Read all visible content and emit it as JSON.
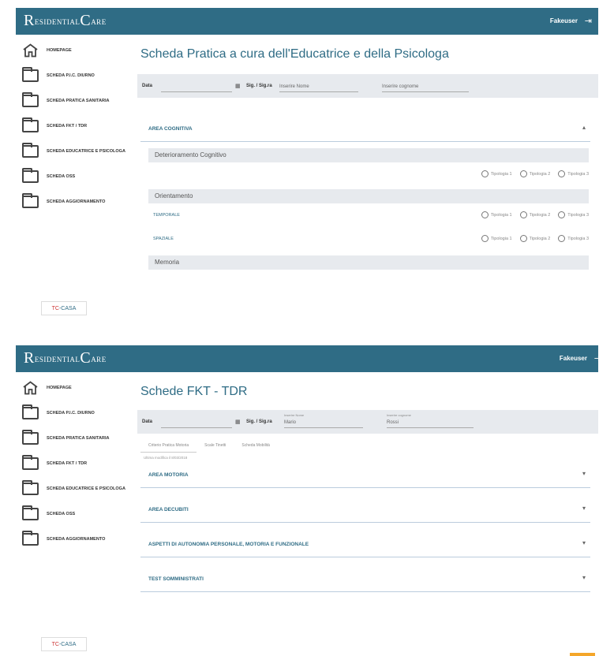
{
  "app": {
    "logo_first": "R",
    "logo_mid": "ESIDENTIAL",
    "logo_second": "C",
    "logo_end": "ARE",
    "user": "Fakeuser",
    "brand_a": "TC",
    "brand_b": "-CASA"
  },
  "sidebar": {
    "items": [
      {
        "label": "HOMEPAGE",
        "icon": "home-icon"
      },
      {
        "label": "SCHEDA P.I.C. DIURNO",
        "icon": "folder-icon"
      },
      {
        "label": "SCHEDA PRATICA SANITARIA",
        "icon": "folder-icon"
      },
      {
        "label": "SCHEDA FKT / TDR",
        "icon": "folder-icon"
      },
      {
        "label": "SCHEDA EDUCATRICE E PSICOLOGA",
        "icon": "folder-icon"
      },
      {
        "label": "SCHEDA OSS",
        "icon": "folder-icon"
      },
      {
        "label": "SCHEDA AGGIORNAMENTO",
        "icon": "folder-icon"
      }
    ]
  },
  "screen1": {
    "title": "Scheda Pratica a cura dell'Educatrice e della Psicologa",
    "filters": {
      "date_label": "Data",
      "person_label": "Sig. / Sig.ra",
      "name_placeholder": "Inserire Nome",
      "surname_placeholder": "Inserire cognome"
    },
    "accordion": "AREA COGNITIVA",
    "accordion_chevron": "▴",
    "sections": [
      {
        "title": "Deterioramento Cognitivo"
      },
      {
        "title": "Orientamento"
      },
      {
        "title": "Memoria"
      }
    ],
    "rows": [
      {
        "label": "",
        "options": [
          "Tipologia 1",
          "Tipologia 2",
          "Tipologia 3"
        ]
      },
      {
        "label": "TEMPORALE",
        "options": [
          "Tipologia 1",
          "Tipologia 2",
          "Tipologia 3"
        ]
      },
      {
        "label": "SPAZIALE",
        "options": [
          "Tipologia 1",
          "Tipologia 2",
          "Tipologia 3"
        ]
      }
    ]
  },
  "screen2": {
    "title": "Schede FKT - TDR",
    "filters": {
      "date_label": "Data",
      "person_label": "Sig. / Sig.ra",
      "name_small": "Inserire Nome",
      "name_value": "Mario",
      "surname_small": "Inserire cognome",
      "surname_value": "Rossi"
    },
    "tabs": [
      "Criterio Pratica Motoria",
      "Scale Tinetti",
      "Scheda Mobilità"
    ],
    "modified": "Ultima modifica il 8/03/2018",
    "accordions": [
      {
        "label": "AREA MOTORIA"
      },
      {
        "label": "AREA DECUBITI"
      },
      {
        "label": "ASPETTI DI AUTONOMIA PERSONALE, MOTORIA E FUNZIONALE"
      },
      {
        "label": "TEST SOMMINISTRATI"
      }
    ],
    "accordion_chevron": "▾"
  },
  "colors": {
    "header": "#2f6c85",
    "accent_orange": "#f4a62a",
    "filter_bg": "#e7eaee"
  }
}
